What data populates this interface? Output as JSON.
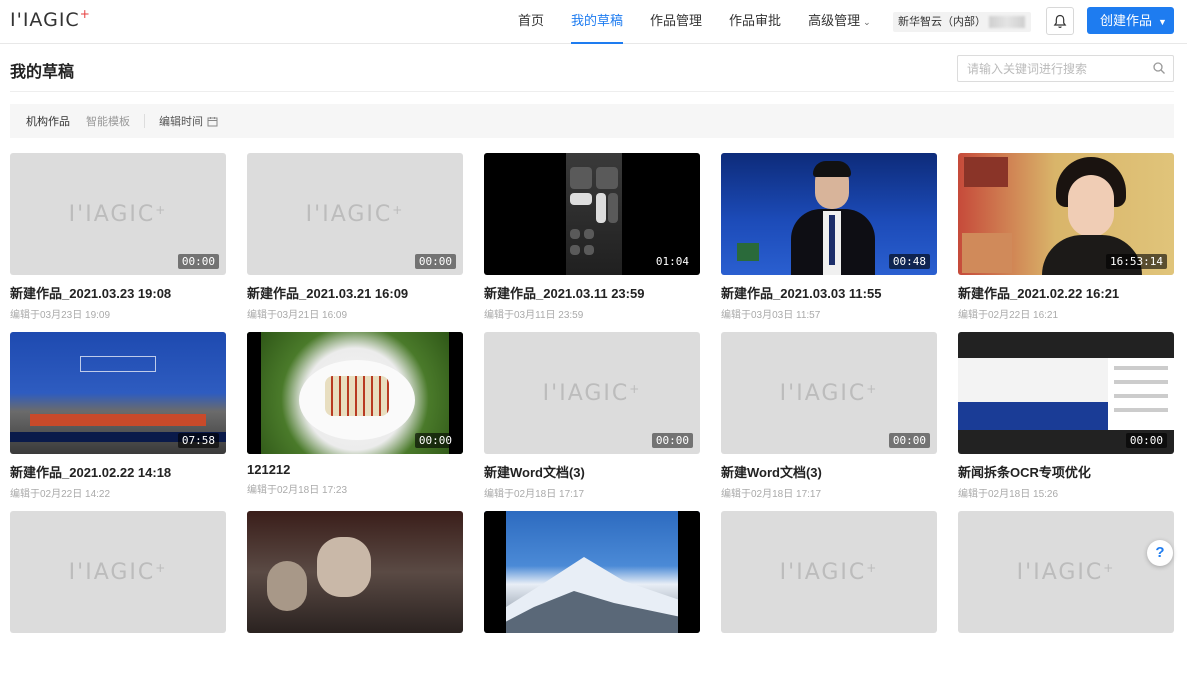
{
  "app": {
    "logo_text": "I'IAGIC",
    "logo_plus": "+"
  },
  "nav": {
    "items": [
      {
        "label": "首页",
        "active": false
      },
      {
        "label": "我的草稿",
        "active": true
      },
      {
        "label": "作品管理",
        "active": false
      },
      {
        "label": "作品审批",
        "active": false
      },
      {
        "label": "高级管理",
        "active": false,
        "has_dropdown": true
      }
    ],
    "org": "新华智云（内部）",
    "create_label": "创建作品",
    "accent": "#1e7cf0"
  },
  "page": {
    "title": "我的草稿",
    "search_placeholder": "请输入关键词进行搜索"
  },
  "filters": {
    "items": [
      {
        "label": "机构作品",
        "active": true
      },
      {
        "label": "智能模板",
        "active": false
      }
    ],
    "sort_label": "编辑时间"
  },
  "placeholder": {
    "text": "I'IAGIC",
    "plus": "+"
  },
  "cards": [
    {
      "title": "新建作品_2021.03.23 19:08",
      "subtitle": "编辑于03月23日 19:09",
      "duration": "00:00",
      "thumb": "placeholder"
    },
    {
      "title": "新建作品_2021.03.21 16:09",
      "subtitle": "编辑于03月21日 16:09",
      "duration": "00:00",
      "thumb": "placeholder"
    },
    {
      "title": "新建作品_2021.03.11 23:59",
      "subtitle": "编辑于03月11日 23:59",
      "duration": "01:04",
      "thumb": "phone"
    },
    {
      "title": "新建作品_2021.03.03 11:55",
      "subtitle": "编辑于03月03日 11:57",
      "duration": "00:48",
      "thumb": "news"
    },
    {
      "title": "新建作品_2021.02.22 16:21",
      "subtitle": "编辑于02月22日 16:21",
      "duration": "16:53:14",
      "thumb": "woman"
    },
    {
      "title": "新建作品_2021.02.22 14:18",
      "subtitle": "编辑于02月22日 14:22",
      "duration": "07:58",
      "thumb": "conference"
    },
    {
      "title": "121212",
      "subtitle": "编辑于02月18日 17:23",
      "duration": "00:00",
      "thumb": "food"
    },
    {
      "title": "新建Word文档(3)",
      "subtitle": "编辑于02月18日 17:17",
      "duration": "00:00",
      "thumb": "placeholder"
    },
    {
      "title": "新建Word文档(3)",
      "subtitle": "编辑于02月18日 17:17",
      "duration": "00:00",
      "thumb": "placeholder"
    },
    {
      "title": "新闻拆条OCR专项优化",
      "subtitle": "编辑于02月18日 15:26",
      "duration": "00:00",
      "thumb": "ocr"
    },
    {
      "title": "",
      "subtitle": "",
      "duration": "",
      "thumb": "placeholder"
    },
    {
      "title": "",
      "subtitle": "",
      "duration": "",
      "thumb": "drama"
    },
    {
      "title": "",
      "subtitle": "",
      "duration": "",
      "thumb": "mountain"
    },
    {
      "title": "",
      "subtitle": "",
      "duration": "",
      "thumb": "placeholder"
    },
    {
      "title": "",
      "subtitle": "",
      "duration": "",
      "thumb": "placeholder"
    }
  ],
  "help": {
    "label": "?"
  }
}
